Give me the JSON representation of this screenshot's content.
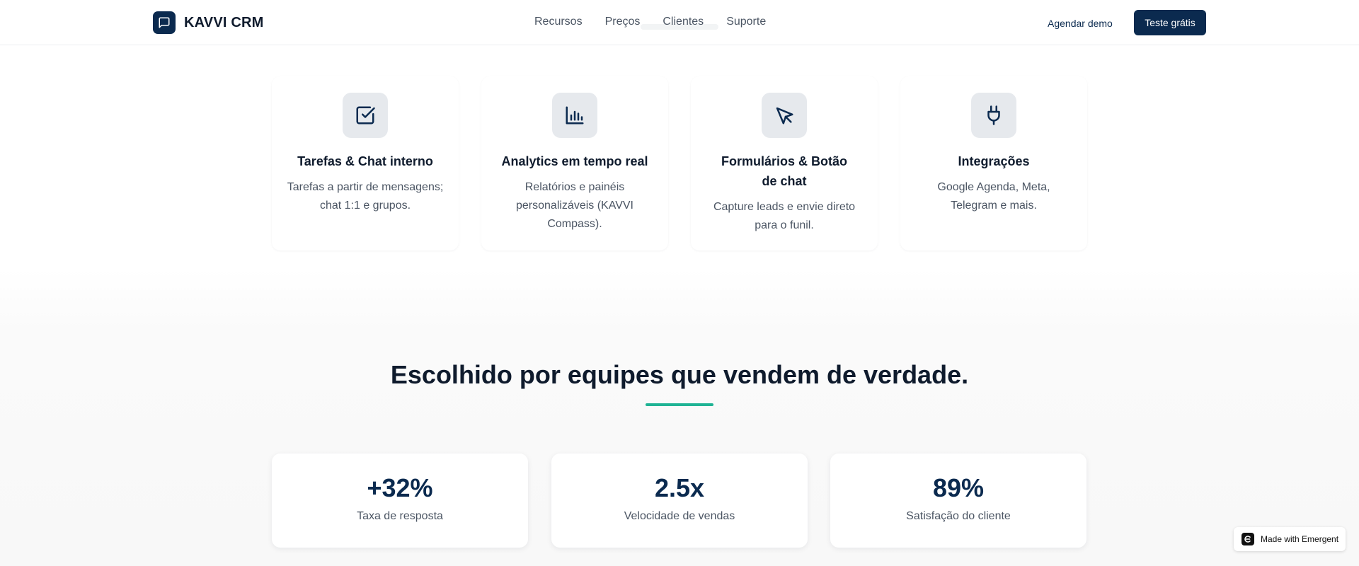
{
  "header": {
    "brand_name": "KAVVI CRM",
    "brand_icon": "chat-bubble-icon",
    "nav": [
      "Recursos",
      "Preços",
      "Clientes",
      "Suporte"
    ],
    "demo_label": "Agendar demo",
    "trial_label": "Teste grátis"
  },
  "features": [
    {
      "icon": "check-square-icon",
      "title": "Tarefas & Chat interno",
      "description": "Tarefas a partir de mensagens; chat 1:1 e grupos."
    },
    {
      "icon": "bar-chart-icon",
      "title": "Analytics em tempo real",
      "description": "Relatórios e painéis personalizáveis (KAVVI Compass)."
    },
    {
      "icon": "cursor-click-icon",
      "title": "Formulários & Botão de chat",
      "description": "Capture leads e envie direto para o funil."
    },
    {
      "icon": "plug-icon",
      "title": "Integrações",
      "description": "Google Agenda, Meta, Telegram e mais."
    }
  ],
  "proof": {
    "title": "Escolhido por equipes que vendem de verdade.",
    "stats": [
      {
        "value": "+32%",
        "label": "Taxa de resposta"
      },
      {
        "value": "2.5x",
        "label": "Velocidade de vendas"
      },
      {
        "value": "89%",
        "label": "Satisfação do cliente"
      }
    ]
  },
  "badge": {
    "label": "Made with Emergent"
  },
  "colors": {
    "primary": "#0b2a4f",
    "accent": "#1fb394",
    "icon_bg": "#e6e9ed",
    "muted_text": "#4b5563"
  }
}
